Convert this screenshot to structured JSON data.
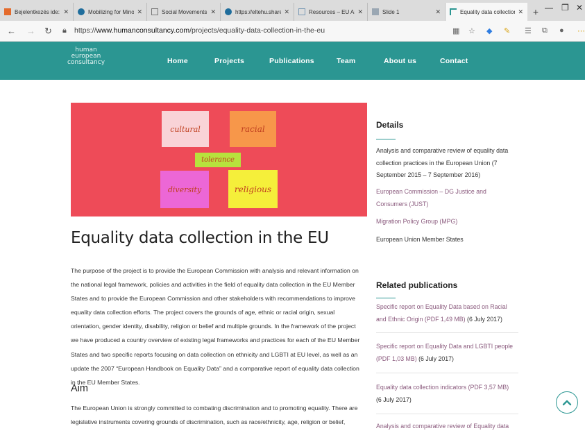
{
  "browser": {
    "tabs": [
      {
        "title": "Bejelentkezés ide: Outl",
        "favicon_color": "#e46b2c"
      },
      {
        "title": "Mobilizing for Minority",
        "favicon_color": "#1f6d9c"
      },
      {
        "title": "Social Movements and",
        "favicon_color": "#777777"
      },
      {
        "title": "https://eltehu.sharepo",
        "favicon_color": "#1f6d9c"
      },
      {
        "title": "Resources – EU Anti-Dis",
        "favicon_color": "#7a9ab5"
      },
      {
        "title": "Slide 1",
        "favicon_color": "#9aa7b3"
      },
      {
        "title": "Equality data collection",
        "favicon_color": "#2b9692"
      }
    ],
    "new_tab": "+",
    "window_controls": {
      "minimize": "—",
      "restore": "❐",
      "close": "✕"
    },
    "url_prefix": "https://",
    "url_host": "www.humanconsultancy.com",
    "url_path": "/projects/equality-data-collection-in-the-eu"
  },
  "site": {
    "logo_lines": [
      "human",
      "european",
      "consultancy"
    ],
    "nav": [
      "Home",
      "Projects",
      "Publications",
      "Team",
      "About us",
      "Contact"
    ]
  },
  "hero": {
    "words": [
      "cultural",
      "racial",
      "tolerance",
      "diversity",
      "religious"
    ]
  },
  "main": {
    "title": "Equality data collection in the EU",
    "body": "The purpose of the project is to provide the European Commission with analysis and relevant information on the national legal framework, policies and activities in the field of equality data collection in the EU Member States and to provide the European Commission and other stakeholders with recommendations to improve equality data collection efforts. The project covers the grounds of age, ethnic or racial origin, sexual orientation, gender identity, disability, religion or belief and multiple grounds. In the framework of the project we have produced a country overview of existing legal frameworks and practices for each of the EU Member States and two specific reports focusing on data collection on ethnicity and LGBTI at EU level, as well as an update the 2007 “European Handbook on Equality Data” and a comparative report of equality data collection in the EU Member States.",
    "aim_heading": "Aim",
    "aim_text": "The European Union is strongly committed to combating discrimination and to promoting equality. There are legislative instruments covering grounds of discrimination, such as race/ethnicity, age, religion or belief,"
  },
  "sidebar": {
    "details_heading": "Details",
    "details_desc": "Analysis and comparative review of equality data collection practices in the European Union (7 September 2015 – 7 September 2016)",
    "client": "European Commission – DG Justice and Consumers (JUST)",
    "partner": "Migration Policy Group (MPG)",
    "scope": "European Union Member States",
    "publications_heading": "Related publications",
    "publications": [
      {
        "link": "Specific report on Equality Data based on Racial and Ethnic Origin (PDF 1,49 MB)",
        "date": "(6 July 2017)"
      },
      {
        "link": "Specific report on Equality Data and LGBTI people (PDF 1,03 MB)",
        "date": "(6 July 2017)"
      },
      {
        "link": "Equality data collection indicators (PDF 3,57 MB)",
        "date": "(6 July 2017)"
      },
      {
        "link": "Analysis and comparative review of Equality data",
        "date": ""
      }
    ]
  },
  "colors": {
    "brand": "#2b9692",
    "hero_bg": "#ee4b58",
    "link": "#8a5a7d"
  }
}
